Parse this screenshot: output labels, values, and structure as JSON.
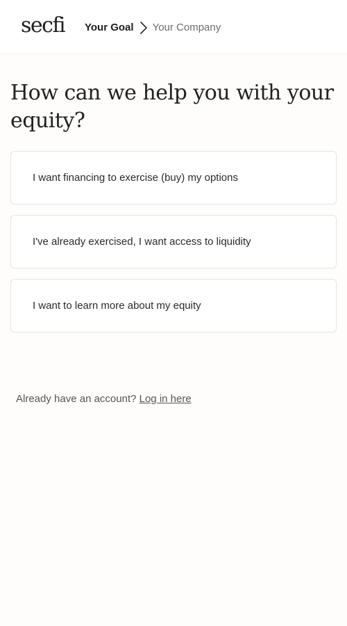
{
  "header": {
    "logo_text": "secfi",
    "breadcrumb": {
      "current": "Your Goal",
      "next": "Your Company",
      "separator_icon": "chevron-right-icon"
    }
  },
  "main": {
    "title": "How can we help you with your equity?",
    "options": [
      {
        "label": "I want financing to exercise (buy) my options"
      },
      {
        "label": "I've already exercised, I want access to liquidity"
      },
      {
        "label": "I want to learn more about my equity"
      }
    ],
    "login": {
      "prompt": "Already have an account?",
      "link_label": "Log in here"
    }
  },
  "colors": {
    "text": "#222222",
    "muted": "#6b6b6b",
    "card_border": "#e6e4e1",
    "background": "#fefdfc"
  }
}
